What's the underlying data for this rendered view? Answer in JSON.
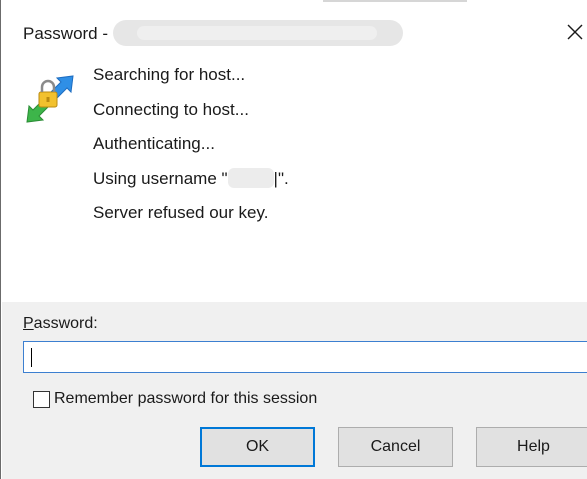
{
  "window": {
    "title_prefix": "Password - "
  },
  "log_lines": [
    "Searching for host...",
    "Connecting to host...",
    "Authenticating...",
    "Server refused our key."
  ],
  "username_line": {
    "prefix": "Using username \"",
    "suffix": "|\"."
  },
  "password": {
    "label_accel": "P",
    "label_rest": "assword:",
    "value": ""
  },
  "remember": {
    "label": "Remember password for this session",
    "checked": false
  },
  "buttons": {
    "ok": "OK",
    "cancel": "Cancel",
    "help": "Help"
  },
  "icons": {
    "close": "close-icon",
    "app": "connection-lock-icon"
  },
  "colors": {
    "focus_border": "#3c7fd0",
    "default_button_border": "#0078d7",
    "panel_background": "#f0f0f0"
  }
}
